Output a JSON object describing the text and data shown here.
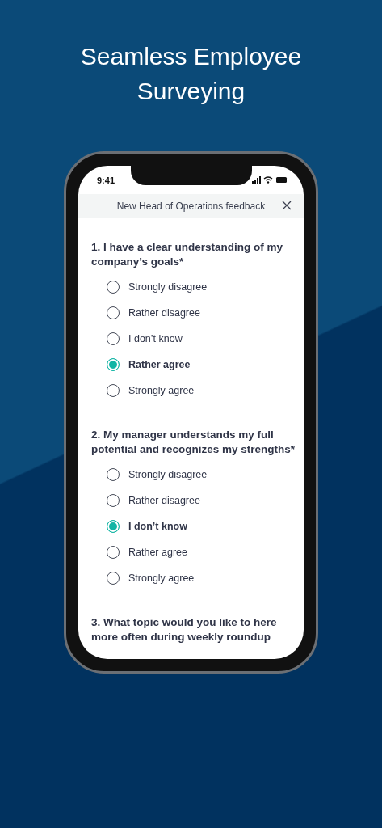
{
  "headline": "Seamless Employee Surveying",
  "status_bar": {
    "time": "9:41"
  },
  "header": {
    "title": "New Head of Operations feedback"
  },
  "questions": [
    {
      "text": "1. I have a clear understanding of my company’s goals*",
      "options": [
        {
          "label": "Strongly disagree",
          "selected": false
        },
        {
          "label": "Rather disagree",
          "selected": false
        },
        {
          "label": "I don’t know",
          "selected": false
        },
        {
          "label": "Rather agree",
          "selected": true
        },
        {
          "label": "Strongly agree",
          "selected": false
        }
      ]
    },
    {
      "text": "2. My manager understands my full potential and recognizes my strengths*",
      "options": [
        {
          "label": "Strongly disagree",
          "selected": false
        },
        {
          "label": "Rather disagree",
          "selected": false
        },
        {
          "label": "I don’t know",
          "selected": true
        },
        {
          "label": "Rather agree",
          "selected": false
        },
        {
          "label": "Strongly agree",
          "selected": false
        }
      ]
    },
    {
      "text": "3. What topic would you like to here more often during weekly roundup"
    }
  ]
}
